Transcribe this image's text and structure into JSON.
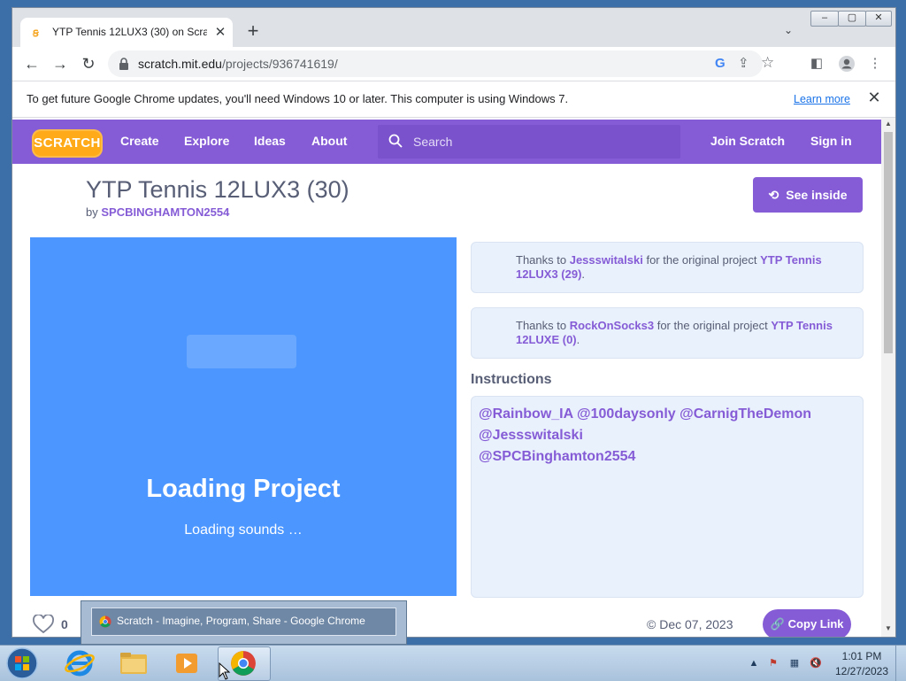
{
  "browser": {
    "tab_title": "YTP Tennis 12LUX3 (30) on Scratch",
    "tab_close": "✕",
    "new_tab": "+",
    "url_host": "scratch.mit.edu",
    "url_path": "/projects/936741619/",
    "infobar_text": "To get future Google Chrome updates, you'll need Windows 10 or later. This computer is using Windows 7.",
    "infobar_link": "Learn more",
    "infobar_close": "✕",
    "window_buttons": [
      "▭",
      "▢",
      "✕"
    ]
  },
  "scratch_nav": {
    "logo": "SCRATCH",
    "links": [
      "Create",
      "Explore",
      "Ideas",
      "About"
    ],
    "search_placeholder": "Search",
    "join": "Join Scratch",
    "signin": "Sign in"
  },
  "project": {
    "title": "YTP Tennis 12LUX3 (30)",
    "by": "by",
    "author": "SPCBINGHAMTON2554",
    "see_inside": "See inside",
    "loading_title": "Loading Project",
    "loading_status": "Loading sounds …",
    "credits": [
      {
        "prefix": "Thanks to",
        "user": "Jessswitalski",
        "middle": "for the original project",
        "project": "YTP Tennis 12LUX3 (29)",
        "suffix": "."
      },
      {
        "prefix": "Thanks to",
        "user": "RockOnSocks3",
        "middle": "for the original project",
        "project": "YTP Tennis 12LUXE (0)",
        "suffix": "."
      }
    ],
    "instructions_label": "Instructions",
    "instructions_lines": [
      "@Rainbow_IA @100daysonly @CarnigTheDemon",
      "@Jessswitalski",
      "@SPCBinghamton2554"
    ],
    "love_count": "0",
    "date": "© Dec 07, 2023",
    "copy_link": "Copy Link"
  },
  "taskbar": {
    "preview_title": "Scratch - Imagine, Program, Share - Google Chrome",
    "time": "1:01 PM",
    "date": "12/27/2023"
  },
  "colors": {
    "scratch_purple": "#855cd6",
    "stage_blue": "#4c97ff",
    "logo_orange": "#ffab19"
  }
}
